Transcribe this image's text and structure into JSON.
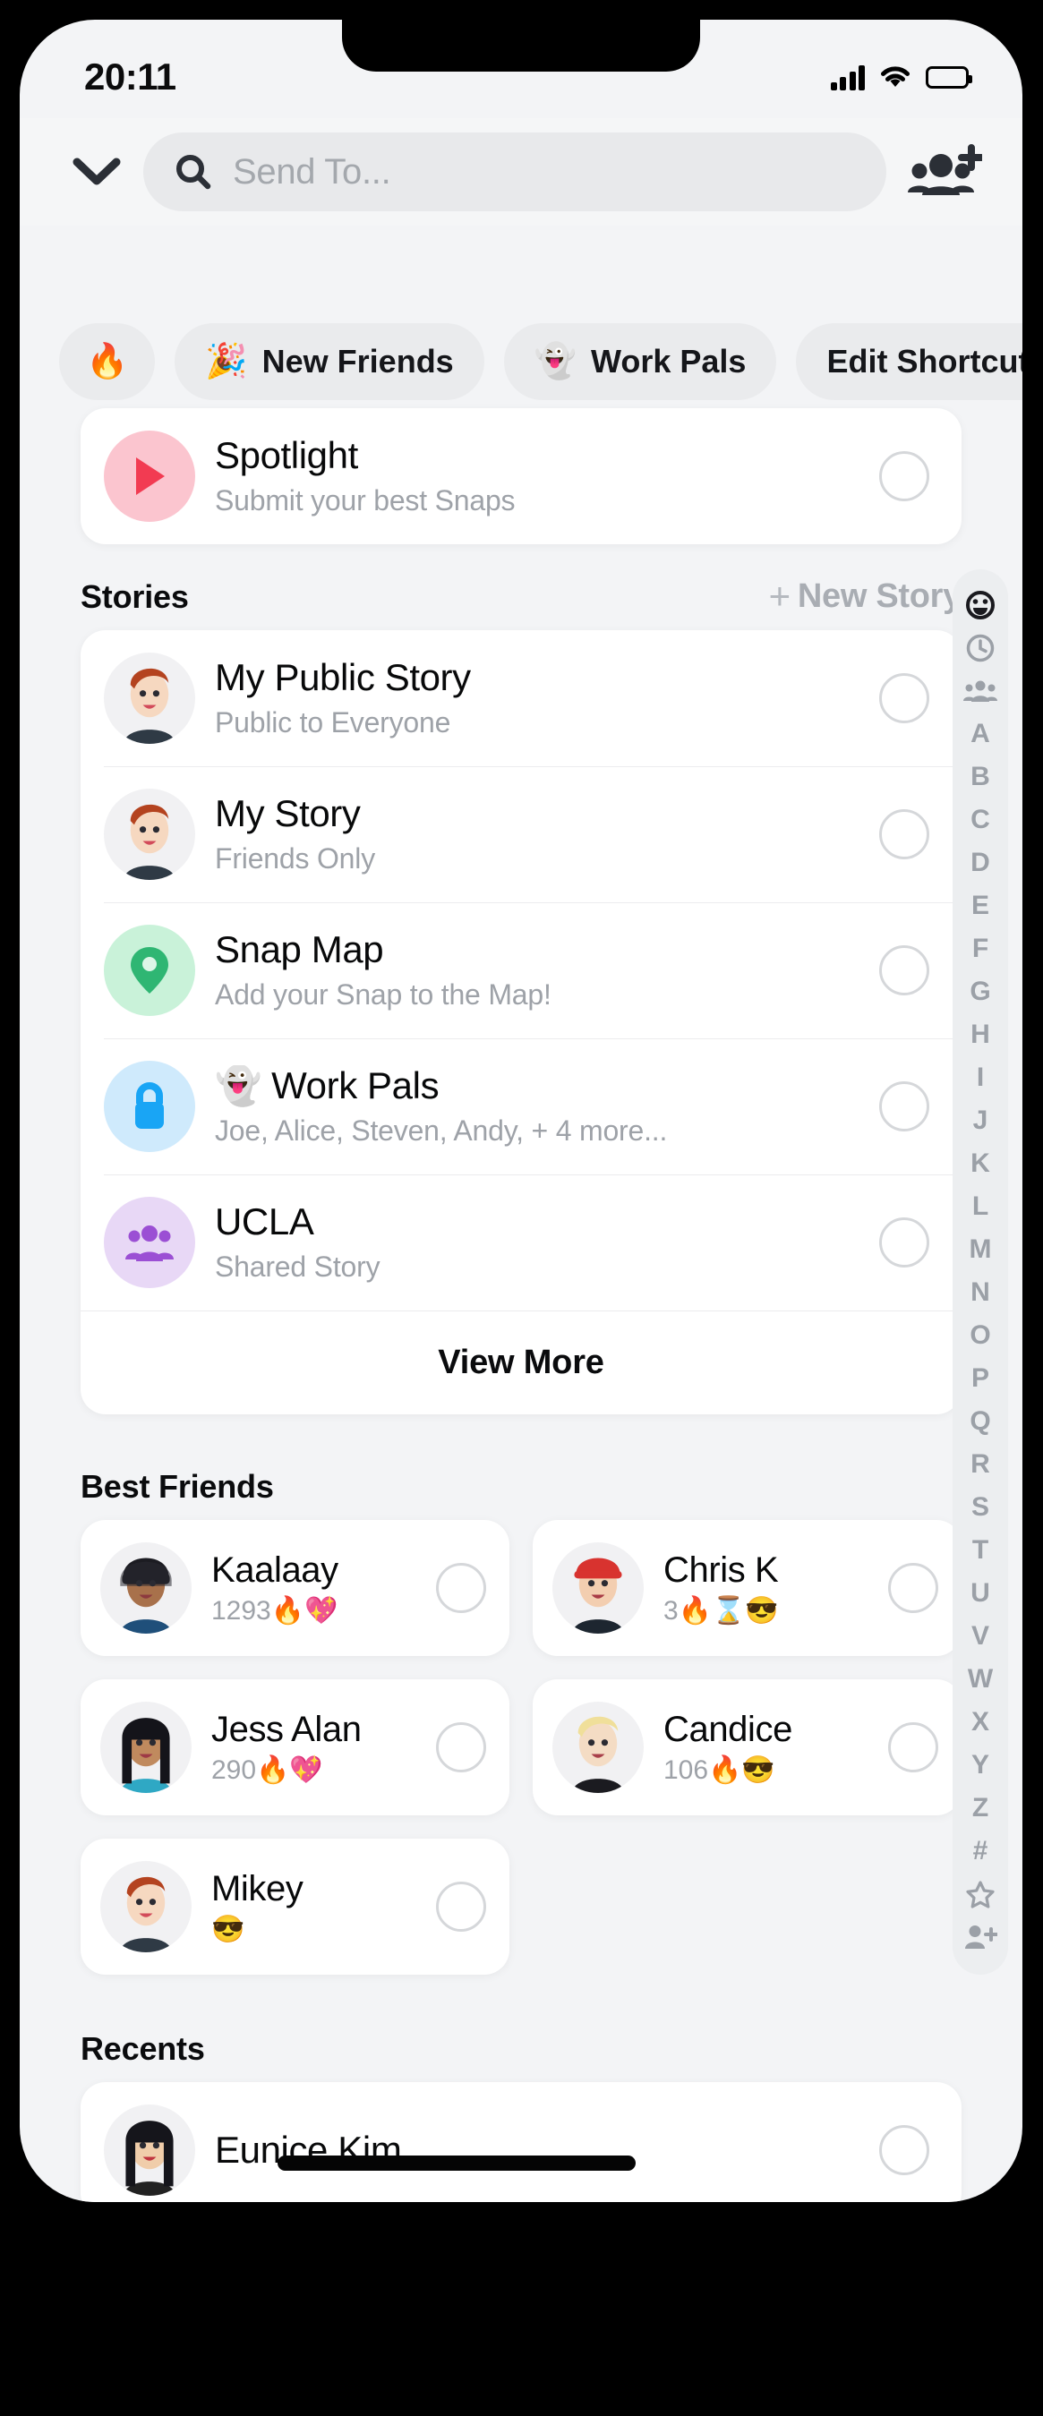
{
  "status_bar": {
    "time": "20:11",
    "signal_icon": "cellular-signal-icon",
    "wifi_icon": "wifi-icon",
    "battery_icon": "battery-full-icon"
  },
  "header": {
    "collapse_icon": "chevron-down-icon",
    "search_placeholder": "Send To...",
    "search_value": "",
    "search_icon": "search-icon",
    "add_friends_icon": "add-friends-icon"
  },
  "shortcut_chips": [
    {
      "emoji": "🔥",
      "label": "",
      "icon_only": true,
      "name": "chip-fire"
    },
    {
      "emoji": "🎉",
      "label": "New Friends",
      "icon_only": false,
      "name": "chip-new-friends"
    },
    {
      "emoji": "👻",
      "label": "Work Pals",
      "icon_only": false,
      "name": "chip-work-pals"
    },
    {
      "emoji": "",
      "label": "Edit Shortcuts",
      "icon_only": false,
      "name": "chip-edit-shortcuts"
    }
  ],
  "spotlight": {
    "title": "Spotlight",
    "subtitle": "Submit your best Snaps",
    "icon": "play-triangle-icon"
  },
  "stories": {
    "section_title": "Stories",
    "new_story_label": "New Story",
    "new_story_plus": "+",
    "view_more_label": "View More",
    "items": [
      {
        "title": "My Public Story",
        "subtitle": "Public to Everyone",
        "avatar": "bitmoji-redhair-avatar",
        "tint": ""
      },
      {
        "title": "My Story",
        "subtitle": "Friends Only",
        "avatar": "bitmoji-redhair-avatar",
        "tint": ""
      },
      {
        "title": "Snap Map",
        "subtitle": "Add your Snap to the Map!",
        "avatar": "map-pin-icon",
        "tint": "tinted-green"
      },
      {
        "title": "👻 Work Pals",
        "subtitle": "Joe, Alice, Steven, Andy, + 4 more...",
        "avatar": "lock-icon",
        "tint": "tinted-blue"
      },
      {
        "title": "UCLA",
        "subtitle": "Shared Story",
        "avatar": "group-people-icon",
        "tint": "tinted-purple"
      }
    ]
  },
  "best_friends": {
    "section_title": "Best Friends",
    "items": [
      {
        "name": "Kaalaay",
        "streak": "1293🔥💖",
        "avatar": "bitmoji-beanie-avatar"
      },
      {
        "name": "Chris K",
        "streak": "3🔥⌛😎",
        "avatar": "bitmoji-redcap-avatar"
      },
      {
        "name": "Jess Alan",
        "streak": "290🔥💖",
        "avatar": "bitmoji-darkhair-avatar"
      },
      {
        "name": "Candice",
        "streak": "106🔥😎",
        "avatar": "bitmoji-blonde-avatar"
      },
      {
        "name": "Mikey",
        "streak": "😎",
        "avatar": "bitmoji-redhair-avatar"
      }
    ]
  },
  "recents": {
    "section_title": "Recents",
    "items": [
      {
        "name": "Eunice Kim",
        "streak": "",
        "avatar": "bitmoji-longhair-avatar",
        "redacted": true
      }
    ]
  },
  "scrubber": {
    "top_icons": [
      "smiley-face-icon",
      "clock-icon",
      "group-people-icon"
    ],
    "letters": [
      "A",
      "B",
      "C",
      "D",
      "E",
      "F",
      "G",
      "H",
      "I",
      "J",
      "K",
      "L",
      "M",
      "N",
      "O",
      "P",
      "Q",
      "R",
      "S",
      "T",
      "U",
      "V",
      "W",
      "X",
      "Y",
      "Z",
      "#"
    ],
    "bottom_icons": [
      "star-icon",
      "add-person-icon"
    ]
  },
  "colors": {
    "screen_bg": "#f3f4f6",
    "card_bg": "#ffffff",
    "chip_bg": "#eaebed",
    "search_bg": "#e8e9eb",
    "muted_text": "#9ea2a8",
    "spotlight_pink": "#fbc5cf",
    "spotlight_red": "#f23b52",
    "map_green": "#2fb673",
    "lock_blue": "#19a5f5",
    "group_purple": "#9b4fd4"
  }
}
